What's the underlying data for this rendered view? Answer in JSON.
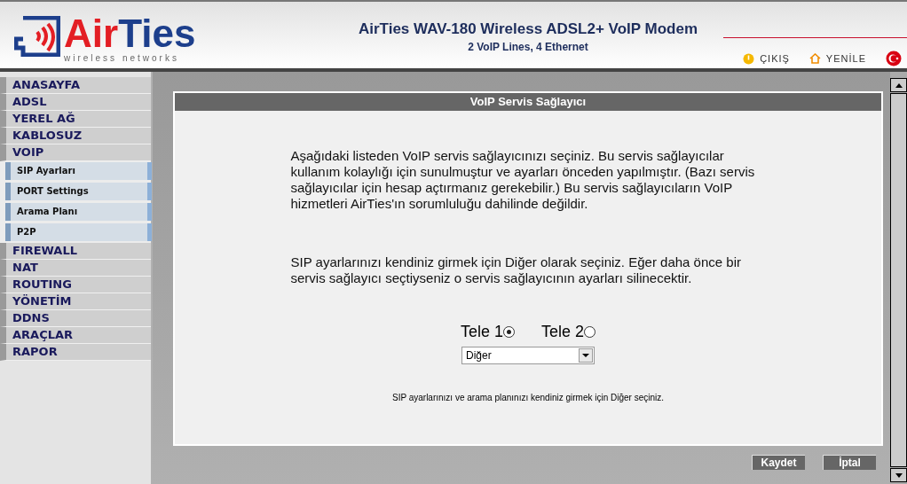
{
  "header": {
    "logo_brand_a": "Air",
    "logo_brand_b": "Ties",
    "logo_tagline": "wireless networks",
    "title": "AirTies WAV-180 Wireless ADSL2+ VoIP Modem",
    "subtitle": "2 VoIP Lines, 4 Ethernet",
    "links": [
      {
        "kind": "logout",
        "label": "ÇIKIŞ"
      },
      {
        "kind": "refresh",
        "label": "YENİLE"
      }
    ]
  },
  "sidebar": {
    "items": [
      {
        "label": "ANASAYFA"
      },
      {
        "label": "ADSL"
      },
      {
        "label": "YEREL AĞ"
      },
      {
        "label": "KABLOSUZ"
      },
      {
        "label": "VOIP",
        "expanded": true,
        "children": [
          {
            "label": "SIP Ayarları"
          },
          {
            "label": "PORT Settings"
          },
          {
            "label": "Arama Planı"
          },
          {
            "label": "P2P"
          }
        ]
      },
      {
        "label": "FIREWALL"
      },
      {
        "label": "NAT"
      },
      {
        "label": "ROUTING"
      },
      {
        "label": "YÖNETİM"
      },
      {
        "label": "DDNS"
      },
      {
        "label": "ARAÇLAR"
      },
      {
        "label": "RAPOR"
      }
    ]
  },
  "panel": {
    "title": "VoIP Servis Sağlayıcı",
    "paragraphs": [
      "Aşağıdaki listeden VoIP servis sağlayıcınızı seçiniz. Bu servis sağlayıcılar kullanım kolaylığı için sunulmuştur ve ayarları önceden yapılmıştır. (Bazı servis sağlayıcılar için hesap açtırmanız gerekebilir.) Bu servis sağlayıcıların VoIP hizmetleri AirTies'ın sorumluluğu dahilinde değildir.",
      "SIP ayarlarınızı kendiniz girmek için Diğer olarak seçiniz. Eğer daha önce bir servis sağlayıcı seçtiyseniz o servis sağlayıcının ayarları silinecektir."
    ],
    "lines": [
      {
        "label": "Tele 1",
        "selected": true
      },
      {
        "label": "Tele 2",
        "selected": false
      }
    ],
    "provider_select": {
      "value": "Diğer"
    },
    "hint": "SIP ayarlarınızı ve arama planınızı kendiniz girmek için Diğer seçiniz."
  },
  "buttons": [
    "Kaydet",
    "İptal"
  ]
}
